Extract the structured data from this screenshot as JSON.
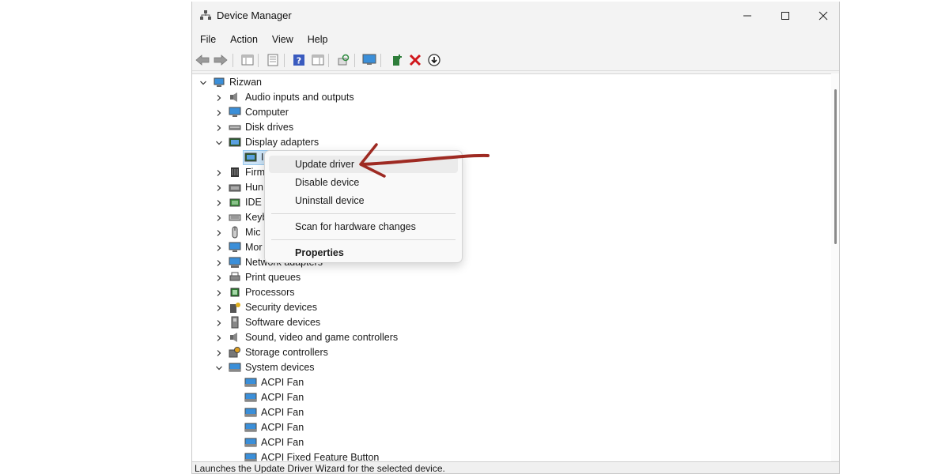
{
  "window": {
    "title": "Device Manager"
  },
  "menubar": [
    "File",
    "Action",
    "View",
    "Help"
  ],
  "tree": {
    "root": "Rizwan",
    "items": [
      {
        "label": "Audio inputs and outputs",
        "icon": "speaker-icon"
      },
      {
        "label": "Computer",
        "icon": "monitor-icon"
      },
      {
        "label": "Disk drives",
        "icon": "disk-drive-icon"
      },
      {
        "label": "Display adapters",
        "icon": "display-adapter-icon"
      },
      {
        "label": "I",
        "icon": "display-adapter-icon"
      },
      {
        "label": "Firm",
        "icon": "firmware-icon"
      },
      {
        "label": "Hun",
        "icon": "hid-icon"
      },
      {
        "label": "IDE /",
        "icon": "ide-controller-icon"
      },
      {
        "label": "Keyb",
        "icon": "keyboard-icon"
      },
      {
        "label": "Mic",
        "icon": "mouse-icon"
      },
      {
        "label": "Mor",
        "icon": "monitor-icon"
      },
      {
        "label": "Network adapters",
        "icon": "network-adapter-icon"
      },
      {
        "label": "Print queues",
        "icon": "printer-icon"
      },
      {
        "label": "Processors",
        "icon": "processor-icon"
      },
      {
        "label": "Security devices",
        "icon": "security-device-icon"
      },
      {
        "label": "Software devices",
        "icon": "software-device-icon"
      },
      {
        "label": "Sound, video and game controllers",
        "icon": "speaker-icon"
      },
      {
        "label": "Storage controllers",
        "icon": "storage-controller-icon"
      },
      {
        "label": "System devices",
        "icon": "system-devices-icon"
      },
      {
        "label": "ACPI Fan",
        "icon": "system-devices-icon"
      },
      {
        "label": "ACPI Fan",
        "icon": "system-devices-icon"
      },
      {
        "label": "ACPI Fan",
        "icon": "system-devices-icon"
      },
      {
        "label": "ACPI Fan",
        "icon": "system-devices-icon"
      },
      {
        "label": "ACPI Fan",
        "icon": "system-devices-icon"
      },
      {
        "label": "ACPI Fixed Feature Button",
        "icon": "system-devices-icon"
      }
    ]
  },
  "context_menu": {
    "update_driver": "Update driver",
    "disable_device": "Disable device",
    "uninstall_device": "Uninstall device",
    "scan_for_hardware_changes": "Scan for hardware changes",
    "properties": "Properties"
  },
  "status_bar": "Launches the Update Driver Wizard for the selected device.",
  "colors": {
    "annotation_arrow": "#9e2a22",
    "menu_highlight": "#ebebeb",
    "help_icon": "#3a5bbf"
  }
}
